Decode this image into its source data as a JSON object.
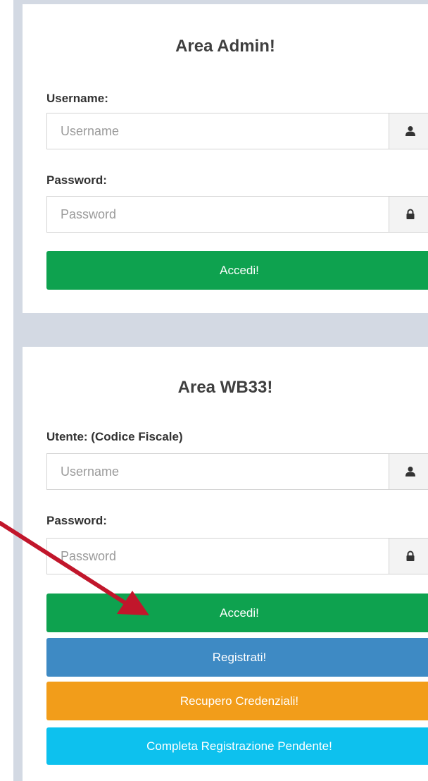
{
  "admin": {
    "title": "Area Admin!",
    "username_label": "Username:",
    "username_placeholder": "Username",
    "password_label": "Password:",
    "password_placeholder": "Password",
    "login_label": "Accedi!"
  },
  "wb33": {
    "title": "Area WB33!",
    "user_label": "Utente: (Codice Fiscale)",
    "username_placeholder": "Username",
    "password_label": "Password:",
    "password_placeholder": "Password",
    "login_label": "Accedi!",
    "register_label": "Registrati!",
    "recover_label": "Recupero Credenziali!",
    "complete_label": "Completa Registrazione Pendente!"
  },
  "icons": {
    "user": "user-icon",
    "lock": "lock-icon",
    "arrow": "pointer-arrow-icon"
  },
  "colors": {
    "success": "#0ea24f",
    "primary": "#3e8ac4",
    "warning": "#f29d1a",
    "info": "#0dc1ee",
    "arrow": "#c1162b",
    "separator": "#d3d9e3"
  }
}
